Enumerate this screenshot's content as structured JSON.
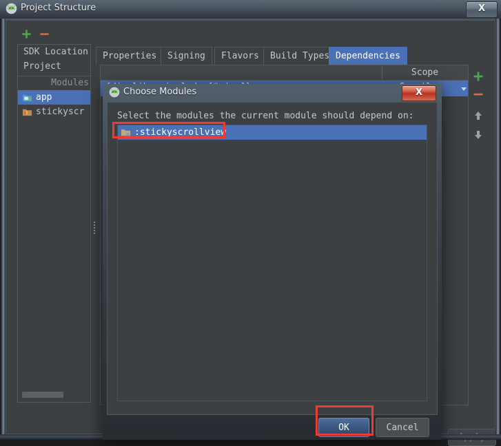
{
  "window": {
    "title": "Project Structure",
    "app_icon": "android-studio-icon",
    "close_label": "X"
  },
  "sidebar": {
    "toolbar": {
      "add_label": "+",
      "remove_label": "−"
    },
    "items": [
      {
        "label": "SDK Location",
        "icon": "",
        "selected": false
      },
      {
        "label": "Project",
        "icon": "",
        "selected": false
      }
    ],
    "group_label": "Modules",
    "modules": [
      {
        "label": "app",
        "icon": "module-app-icon",
        "selected": true
      },
      {
        "label": "stickyscr",
        "icon": "module-library-icon",
        "selected": false
      }
    ]
  },
  "main": {
    "tabs": [
      {
        "label": "Properties",
        "active": false
      },
      {
        "label": "Signing",
        "active": false
      },
      {
        "label": "Flavors",
        "active": false
      },
      {
        "label": "Build Types",
        "active": false
      },
      {
        "label": "Dependencies",
        "active": true
      }
    ],
    "dependencies_table": {
      "columns": [
        "",
        "Scope"
      ],
      "rows": [
        {
          "name": "{dir=libs, include=[*.jar]}",
          "scope": "Compile",
          "selected": true
        }
      ]
    },
    "actions": [
      {
        "name": "add-dependency",
        "label": "+"
      },
      {
        "name": "remove-dependency",
        "label": "−"
      },
      {
        "name": "move-up",
        "label": "↑"
      },
      {
        "name": "move-down",
        "label": "↓"
      }
    ],
    "apply_label": "Apply"
  },
  "dialog": {
    "title": "Choose Modules",
    "icon": "android-studio-icon",
    "close_label": "X",
    "prompt": "Select the modules the current module should depend on:",
    "modules": [
      {
        "label": ":stickyscrollview",
        "icon": "module-folder-icon",
        "selected": true
      }
    ],
    "ok_label": "OK",
    "cancel_label": "Cancel"
  },
  "colors": {
    "background": "#3c4043",
    "selection_blue": "#4a70b5",
    "annotation_red": "#ef3b35",
    "accent_green": "#4ca64c",
    "accent_orange": "#d07a50"
  }
}
